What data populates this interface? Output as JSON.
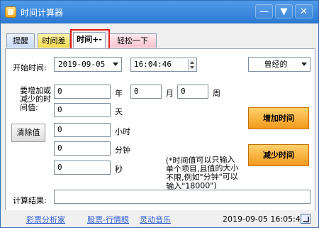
{
  "window": {
    "title": "时间计算器",
    "controls": {
      "minimize": "—",
      "menu": "▼",
      "close": "✕"
    }
  },
  "tabs": [
    "提醒",
    "时间差",
    "时间+-",
    "轻松一下"
  ],
  "start": {
    "label": "开始时间:",
    "date": "2019-09-05",
    "time": "16:04:46",
    "preset": "曾经的"
  },
  "add": {
    "label": "要增加或减少的时间值:",
    "year": "0",
    "month": "0",
    "week": "0",
    "day": "0",
    "hour": "0",
    "minute": "0",
    "second": "0",
    "units": {
      "year": "年",
      "month": "月",
      "week": "周",
      "day": "天",
      "hour": "小时",
      "minute": "分钟",
      "second": "秒"
    }
  },
  "buttons": {
    "clear": "清除值",
    "add": "增加时间",
    "subtract": "减少时间"
  },
  "note": "(*时间值可以只输入单个项目,且值的大小不限,例如\"分钟\"可以输入\"18000\")",
  "result": {
    "label": "计算结果:",
    "value": ""
  },
  "footer_links": [
    "彩票分析家",
    "股票-行情眼",
    "灵动音乐"
  ],
  "status": {
    "datetime": "2019-09-05 16:05:44",
    "icon": "resize-icon"
  }
}
